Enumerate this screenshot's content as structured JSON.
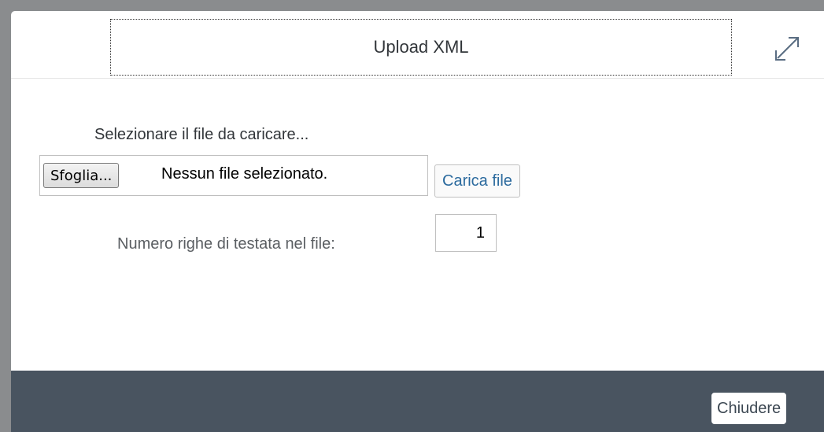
{
  "dialog": {
    "title": "Upload XML",
    "expand_icon": "expand-icon"
  },
  "upload": {
    "instruction": "Selezionare il file da caricare...",
    "browse_label": "Sfoglia...",
    "file_status": "Nessun file selezionato.",
    "upload_button_label": "Carica file"
  },
  "header_rows": {
    "label": "Numero righe di testata nel file:",
    "value": "1"
  },
  "footer": {
    "close_label": "Chiudere"
  },
  "colors": {
    "backdrop": "#8a8c8e",
    "footer_bg": "#495460",
    "link_blue": "#2b6a9e"
  }
}
